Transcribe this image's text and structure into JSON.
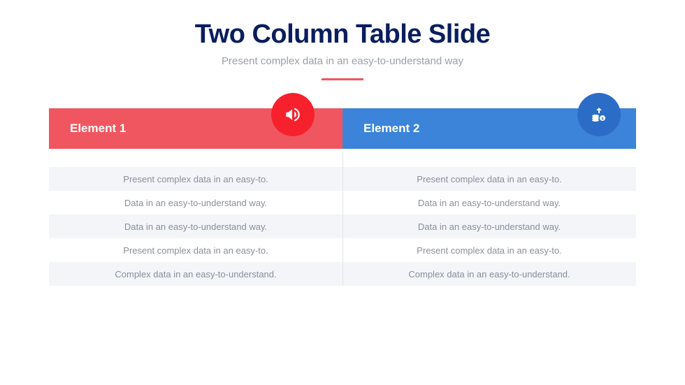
{
  "header": {
    "title": "Two Column Table Slide",
    "subtitle": "Present complex data in an easy-to-understand way"
  },
  "columns": [
    {
      "label": "Element 1",
      "color": "#f05660",
      "icon": "megaphone-icon",
      "rows": [
        "Present complex data in an easy-to.",
        "Data in an easy-to-understand way.",
        "Data in an easy-to-understand way.",
        "Present complex data in an easy-to.",
        "Complex data in an easy-to-understand."
      ]
    },
    {
      "label": "Element 2",
      "color": "#3b84d9",
      "icon": "money-coins-icon",
      "rows": [
        "Present complex data in an easy-to.",
        "Data in an easy-to-understand way.",
        "Data in an easy-to-understand way.",
        "Present complex data in an easy-to.",
        "Complex data in an easy-to-understand."
      ]
    }
  ]
}
